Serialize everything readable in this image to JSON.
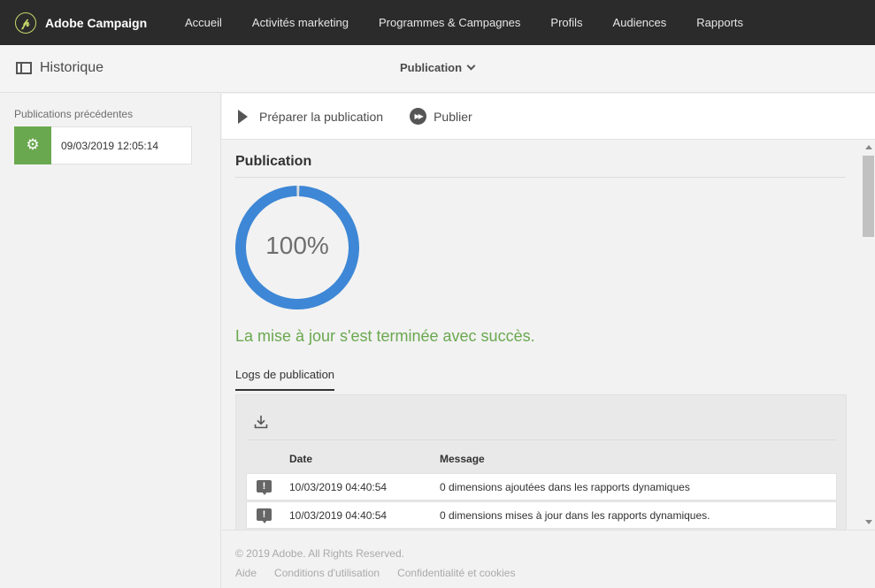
{
  "app": {
    "name": "Adobe Campaign",
    "logo_icon": "adobe-campaign-logo-icon"
  },
  "nav": {
    "items": [
      {
        "label": "Accueil"
      },
      {
        "label": "Activités marketing"
      },
      {
        "label": "Programmes & Campagnes"
      },
      {
        "label": "Profils"
      },
      {
        "label": "Audiences"
      },
      {
        "label": "Rapports"
      }
    ]
  },
  "subheader": {
    "title": "Historique",
    "title_icon": "sidebar-panel-icon",
    "menu_label": "Publication",
    "menu_icon": "chevron-down-icon"
  },
  "sidebar": {
    "title": "Publications précédentes",
    "items": [
      {
        "date": "09/03/2019 12:05:14",
        "icon": "gears-icon",
        "color": "#6aa84f"
      }
    ]
  },
  "toolbar": {
    "prepare_label": "Préparer la publication",
    "prepare_icon": "play-icon",
    "publish_label": "Publier",
    "publish_icon": "fast-forward-icon"
  },
  "publication": {
    "title": "Publication",
    "progress": 100,
    "progress_text": "100%",
    "progress_color": "#3d87d6",
    "status_message": "La mise à jour s'est terminée avec succès.",
    "status_color": "#6aa84f"
  },
  "logs": {
    "tab_label": "Logs de publication",
    "download_icon": "download-icon",
    "columns": {
      "date": "Date",
      "message": "Message"
    },
    "rows": [
      {
        "icon": "warning-icon",
        "date": "10/03/2019 04:40:54",
        "message": "0 dimensions ajoutées dans les rapports dynamiques"
      },
      {
        "icon": "warning-icon",
        "date": "10/03/2019 04:40:54",
        "message": "0 dimensions mises à jour dans les rapports dynamiques."
      }
    ]
  },
  "footer": {
    "copyright": "© 2019 Adobe. All Rights Reserved.",
    "links": [
      {
        "label": "Aide"
      },
      {
        "label": "Conditions d'utilisation"
      },
      {
        "label": "Confidentialité et cookies"
      }
    ]
  }
}
